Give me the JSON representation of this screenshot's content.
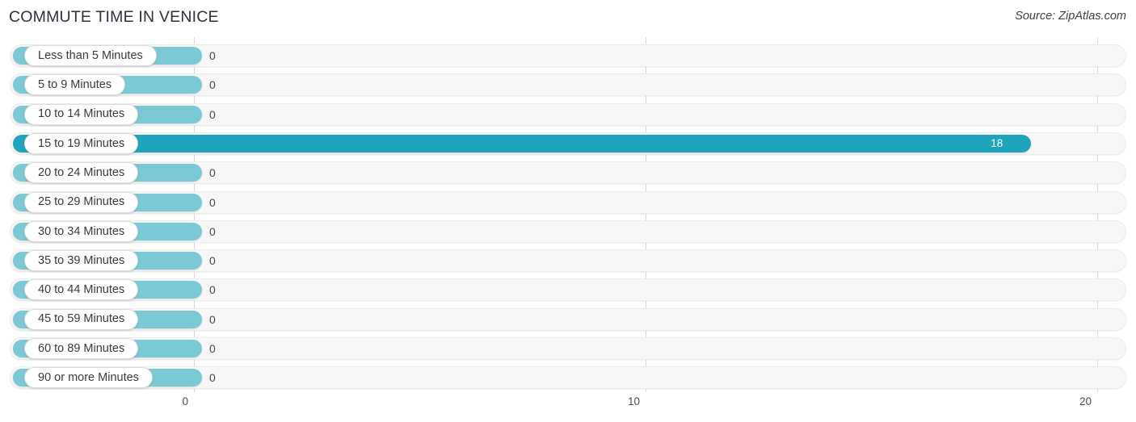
{
  "header": {
    "title": "COMMUTE TIME IN VENICE",
    "source": "Source: ZipAtlas.com"
  },
  "axis": {
    "ticks": [
      "0",
      "10",
      "20"
    ]
  },
  "chart_data": {
    "type": "bar",
    "orientation": "horizontal",
    "title": "COMMUTE TIME IN VENICE",
    "xlabel": "",
    "ylabel": "",
    "xlim": [
      0,
      20
    ],
    "grid": true,
    "legend": false,
    "source": "Source: ZipAtlas.com",
    "tick_values": [
      0,
      10,
      20
    ],
    "tick_labels": [
      "0",
      "10",
      "20"
    ],
    "categories": [
      "Less than 5 Minutes",
      "5 to 9 Minutes",
      "10 to 14 Minutes",
      "15 to 19 Minutes",
      "20 to 24 Minutes",
      "25 to 29 Minutes",
      "30 to 34 Minutes",
      "35 to 39 Minutes",
      "40 to 44 Minutes",
      "45 to 59 Minutes",
      "60 to 89 Minutes",
      "90 or more Minutes"
    ],
    "values": [
      0,
      0,
      0,
      18,
      0,
      0,
      0,
      0,
      0,
      0,
      0,
      0
    ],
    "value_labels": [
      "0",
      "0",
      "0",
      "18",
      "0",
      "0",
      "0",
      "0",
      "0",
      "0",
      "0",
      "0"
    ],
    "highlight_index": 3,
    "colors": {
      "bar": "#7ac9d4",
      "bar_highlight": "#1fa5bb",
      "track": "#f7f7f7",
      "gridline": "#d9d9d9",
      "title_text": "#2e323a",
      "value_text": "#43474d",
      "value_text_inside": "#ffffff"
    }
  },
  "rows": [
    {
      "label": "Less than 5 Minutes",
      "value": 0,
      "value_label": "0",
      "highlight": false
    },
    {
      "label": "5 to 9 Minutes",
      "value": 0,
      "value_label": "0",
      "highlight": false
    },
    {
      "label": "10 to 14 Minutes",
      "value": 0,
      "value_label": "0",
      "highlight": false
    },
    {
      "label": "15 to 19 Minutes",
      "value": 18,
      "value_label": "18",
      "highlight": true
    },
    {
      "label": "20 to 24 Minutes",
      "value": 0,
      "value_label": "0",
      "highlight": false
    },
    {
      "label": "25 to 29 Minutes",
      "value": 0,
      "value_label": "0",
      "highlight": false
    },
    {
      "label": "30 to 34 Minutes",
      "value": 0,
      "value_label": "0",
      "highlight": false
    },
    {
      "label": "35 to 39 Minutes",
      "value": 0,
      "value_label": "0",
      "highlight": false
    },
    {
      "label": "40 to 44 Minutes",
      "value": 0,
      "value_label": "0",
      "highlight": false
    },
    {
      "label": "45 to 59 Minutes",
      "value": 0,
      "value_label": "0",
      "highlight": false
    },
    {
      "label": "60 to 89 Minutes",
      "value": 0,
      "value_label": "0",
      "highlight": false
    },
    {
      "label": "90 or more Minutes",
      "value": 0,
      "value_label": "0",
      "highlight": false
    }
  ]
}
